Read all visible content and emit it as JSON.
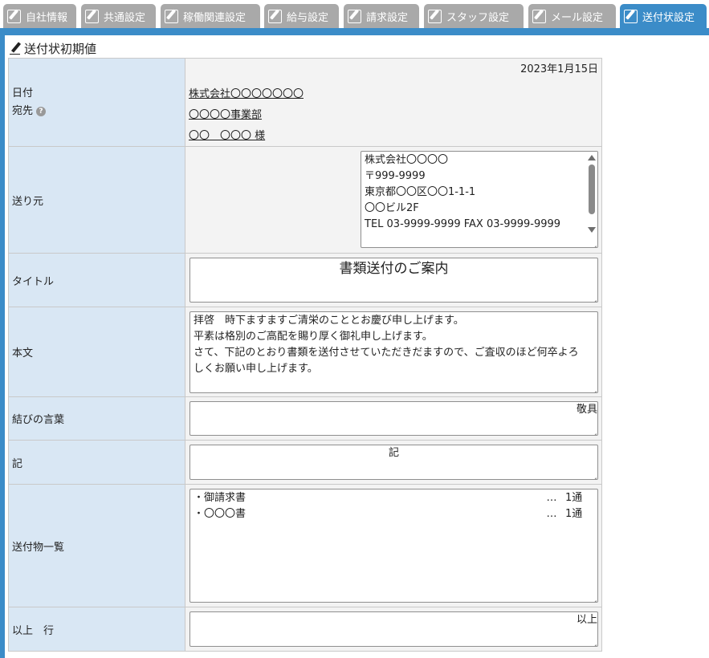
{
  "tabs": [
    {
      "label": "自社情報",
      "active": false
    },
    {
      "label": "共通設定",
      "active": false
    },
    {
      "label": "稼働関連設定",
      "active": false
    },
    {
      "label": "給与設定",
      "active": false
    },
    {
      "label": "請求設定",
      "active": false
    },
    {
      "label": "スタッフ設定",
      "active": false
    },
    {
      "label": "メール設定",
      "active": false
    },
    {
      "label": "送付状設定",
      "active": true
    }
  ],
  "section_title": "送付状初期値",
  "rows": {
    "date": {
      "label_date": "日付",
      "label_to": "宛先",
      "value_date": "2023年1月15日",
      "to_lines": [
        "株式会社〇〇〇〇〇〇〇",
        "〇〇〇〇事業部",
        "〇〇　〇〇〇 様"
      ]
    },
    "from": {
      "label": "送り元",
      "lines": [
        "株式会社〇〇〇〇",
        "〒999-9999",
        "東京都〇〇区〇〇1-1-1",
        "〇〇ビル2F",
        "TEL 03-9999-9999  FAX 03-9999-9999"
      ]
    },
    "title": {
      "label": "タイトル",
      "value": "書類送付のご案内"
    },
    "body": {
      "label": "本文",
      "lines": [
        "拝啓　時下ますますご清栄のこととお慶び申し上げます。",
        "平素は格別のご高配を賜り厚く御礼申し上げます。",
        "さて、下記のとおり書類を送付させていただきだますので、ご査収のほど何卒よろ",
        "しくお願い申し上げます。"
      ]
    },
    "closing": {
      "label": "結びの言葉",
      "value": "敬具"
    },
    "ki": {
      "label": "記",
      "value": "記"
    },
    "list": {
      "label": "送付物一覧",
      "items": [
        {
          "name": "・御請求書",
          "dots": "…",
          "qty": "1通"
        },
        {
          "name": "・〇〇〇書",
          "dots": "…",
          "qty": "1通"
        }
      ]
    },
    "end": {
      "label": "以上　行",
      "value": "以上"
    }
  }
}
